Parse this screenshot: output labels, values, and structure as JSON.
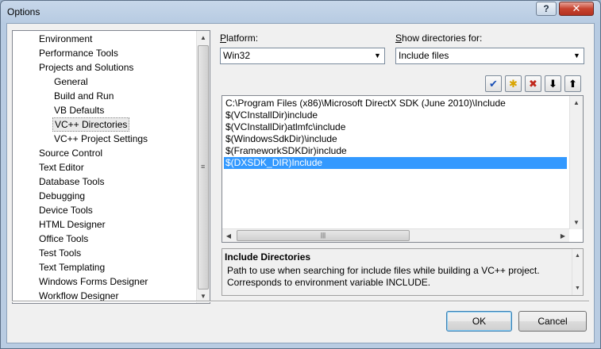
{
  "window": {
    "title": "Options",
    "help_label": "?",
    "close_label": "✕"
  },
  "tree": {
    "items": [
      {
        "label": "Environment"
      },
      {
        "label": "Performance Tools"
      },
      {
        "label": "Projects and Solutions"
      },
      {
        "label": "General"
      },
      {
        "label": "Build and Run"
      },
      {
        "label": "VB Defaults"
      },
      {
        "label": "VC++ Directories",
        "selected": true
      },
      {
        "label": "VC++ Project Settings"
      },
      {
        "label": "Source Control"
      },
      {
        "label": "Text Editor"
      },
      {
        "label": "Database Tools"
      },
      {
        "label": "Debugging"
      },
      {
        "label": "Device Tools"
      },
      {
        "label": "HTML Designer"
      },
      {
        "label": "Office Tools"
      },
      {
        "label": "Test Tools"
      },
      {
        "label": "Text Templating"
      },
      {
        "label": "Windows Forms Designer"
      },
      {
        "label": "Workflow Designer"
      }
    ]
  },
  "platform": {
    "label_prefix": "P",
    "label_rest": "latform:",
    "value": "Win32"
  },
  "show_dirs": {
    "label_prefix": "S",
    "label_rest": "how directories for:",
    "value": "Include files"
  },
  "toolbar": {
    "check_glyph": "✔",
    "new_folder_glyph": "✱",
    "delete_glyph": "✖",
    "down_glyph": "⬇",
    "up_glyph": "⬆"
  },
  "directories": {
    "items": [
      {
        "path": "C:\\Program Files (x86)\\Microsoft DirectX SDK (June 2010)\\Include"
      },
      {
        "path": "$(VCInstallDir)include"
      },
      {
        "path": "$(VCInstallDir)atlmfc\\include"
      },
      {
        "path": "$(WindowsSdkDir)\\include"
      },
      {
        "path": "$(FrameworkSDKDir)include"
      },
      {
        "path": "$(DXSDK_DIR)Include",
        "selected": true
      }
    ]
  },
  "description": {
    "title": "Include Directories",
    "body": "Path to use when searching for include files while building a VC++ project. Corresponds to environment variable INCLUDE."
  },
  "buttons": {
    "ok": "OK",
    "cancel": "Cancel"
  },
  "scroll_glyphs": {
    "up": "▲",
    "down": "▼",
    "left": "◀",
    "right": "▶",
    "grip_v": "≡",
    "grip_h": "|||"
  }
}
